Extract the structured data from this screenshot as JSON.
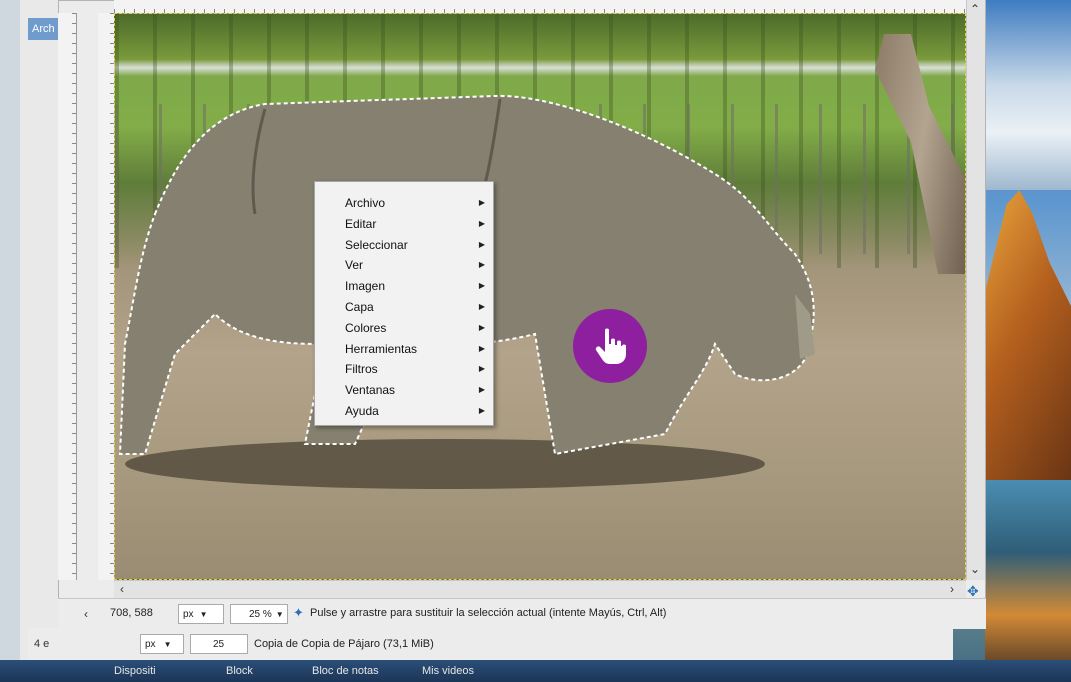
{
  "background_window": {
    "tab_label": "Arch",
    "status_left": "4 e"
  },
  "canvas_window": {
    "coords": "708, 588",
    "unit": "px",
    "zoom": "25 %",
    "status_message": "Pulse y arrastre para sustituir la selección actual (intente Mayús, Ctrl, Alt)"
  },
  "second_window": {
    "unit": "px",
    "zoom": "25 %",
    "image_info": "Copia de Copia de Pájaro (73,1 MiB)"
  },
  "context_menu": {
    "items": [
      {
        "label": "Archivo"
      },
      {
        "label": "Editar"
      },
      {
        "label": "Seleccionar"
      },
      {
        "label": "Ver"
      },
      {
        "label": "Imagen"
      },
      {
        "label": "Capa"
      },
      {
        "label": "Colores"
      },
      {
        "label": "Herramientas"
      },
      {
        "label": "Filtros"
      },
      {
        "label": "Ventanas"
      },
      {
        "label": "Ayuda"
      }
    ]
  },
  "taskbar": {
    "items": [
      "Dispositi",
      "Block",
      "Bloc de notas",
      "Mis videos"
    ]
  },
  "colors": {
    "click_marker": "#8e1f9f",
    "selection_outline": "#ffffff",
    "menu_background": "#f2f2f2"
  },
  "icons": {
    "pointer": "hand-pointer-icon",
    "submenu": "chevron-right-icon",
    "navigate": "move-cross-icon",
    "tool_hint": "lasso-tool-icon"
  }
}
